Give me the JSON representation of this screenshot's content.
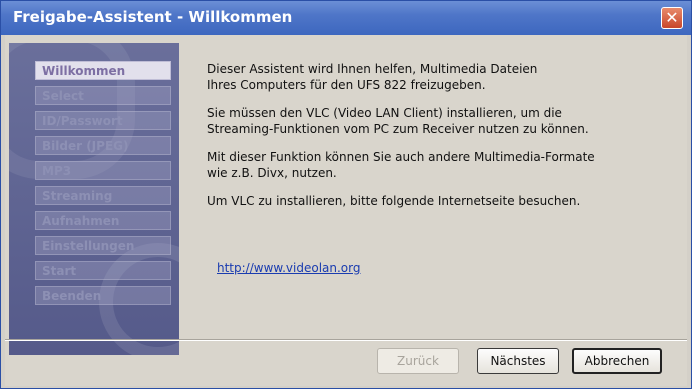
{
  "window": {
    "title": "Freigabe-Assistent - Willkommen",
    "close_glyph": "✕"
  },
  "sidebar": {
    "items": [
      {
        "label": "Willkommen",
        "active": true
      },
      {
        "label": "Select",
        "active": false
      },
      {
        "label": "ID/Passwort",
        "active": false
      },
      {
        "label": "Bilder (JPEG)",
        "active": false
      },
      {
        "label": "MP3",
        "active": false
      },
      {
        "label": "Streaming",
        "active": false
      },
      {
        "label": "Aufnahmen",
        "active": false
      },
      {
        "label": "Einstellungen",
        "active": false
      },
      {
        "label": "Start",
        "active": false
      },
      {
        "label": "Beenden",
        "active": false
      }
    ]
  },
  "content": {
    "para1": "Dieser Assistent wird Ihnen helfen, Multimedia Dateien\nIhres Computers für den UFS 822 freizugeben.",
    "para2": "Sie müssen den VLC (Video LAN Client) installieren, um die\nStreaming-Funktionen vom PC zum Receiver nutzen zu können.",
    "para3": "Mit dieser Funktion können Sie auch andere Multimedia-Formate\nwie z.B. Divx, nutzen.",
    "para4": "Um VLC zu installieren, bitte folgende Internetseite besuchen.",
    "link": "http://www.videolan.org"
  },
  "buttons": {
    "back": "Zurück",
    "next": "Nächstes",
    "cancel": "Abbrechen"
  },
  "colors": {
    "titlebar": "#3d67bf",
    "sidebar": "#555a8a",
    "link": "#1a3cb0"
  }
}
